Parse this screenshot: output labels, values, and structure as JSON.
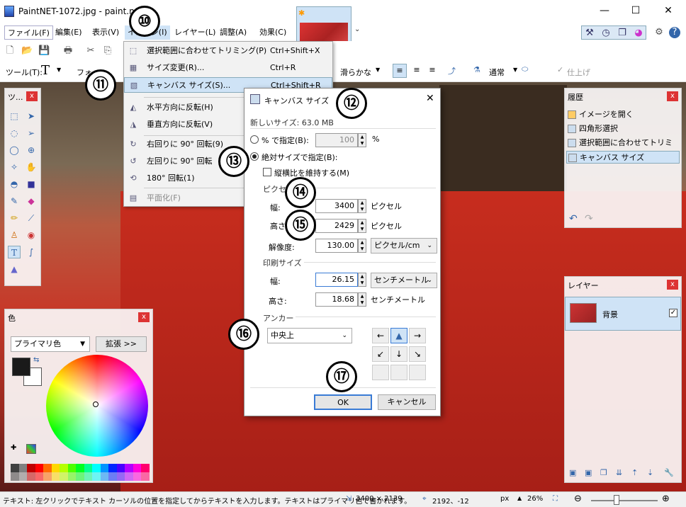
{
  "window": {
    "title": "PaintNET-1072.jpg - paint.net",
    "minimize": "—",
    "maximize": "☐",
    "close": "✕"
  },
  "menubar": {
    "items": [
      "ファイル(F)",
      "編集(E)",
      "表示(V)",
      "イメージ(I)",
      "レイヤー(L)",
      "調整(A)",
      "効果(C)"
    ]
  },
  "toolbar2": {
    "tool_label": "ツール(T):",
    "font_label": "フォ",
    "smoothing": "滑らかな",
    "blend": "通常",
    "finish": "仕上げ"
  },
  "image_menu": {
    "items": [
      {
        "label": "選択範囲に合わせてトリミング(P)",
        "shortcut": "Ctrl+Shift+X"
      },
      {
        "label": "サイズ変更(R)...",
        "shortcut": "Ctrl+R"
      },
      {
        "label": "キャンバス サイズ(S)...",
        "shortcut": "Ctrl+Shift+R"
      },
      {
        "label": "水平方向に反転(H)",
        "shortcut": ""
      },
      {
        "label": "垂直方向に反転(V)",
        "shortcut": ""
      },
      {
        "label": "右回りに 90° 回転(9)",
        "shortcut": ""
      },
      {
        "label": "左回りに 90° 回転",
        "shortcut": ""
      },
      {
        "label": "180° 回転(1)",
        "shortcut": ""
      },
      {
        "label": "平面化(F)",
        "shortcut": ""
      }
    ]
  },
  "tools_panel": {
    "title": "ツ..."
  },
  "colors_panel": {
    "title": "色",
    "mode": "プライマリ色",
    "expand": "拡張 >>",
    "primary_color": "#1a1a1a",
    "secondary_color": "#ffffff",
    "palette": [
      "#404040",
      "#808080",
      "#c00000",
      "#ff0000",
      "#ff6a00",
      "#ffd800",
      "#b6ff00",
      "#4cff00",
      "#00ff21",
      "#00ff90",
      "#00ffff",
      "#0094ff",
      "#0026ff",
      "#4800ff",
      "#b200ff",
      "#ff00dc",
      "#ff006e"
    ]
  },
  "history_panel": {
    "title": "履歴",
    "items": [
      "イメージを開く",
      "四角形選択",
      "選択範囲に合わせてトリミング",
      "キャンバス サイズ"
    ]
  },
  "layers_panel": {
    "title": "レイヤー",
    "layer_name": "背景"
  },
  "dialog": {
    "title": "キャンバス サイズ",
    "new_size": "新しいサイズ: 63.0 MB",
    "by_percent": "% で指定(B):",
    "percent_value": "100",
    "percent_unit": "%",
    "by_absolute": "絶対サイズで指定(B):",
    "keep_ratio": "縦横比を維持する(M)",
    "pixel_group": "ピクセ",
    "width_label": "幅:",
    "width_px": "3400",
    "height_label": "高さ:",
    "height_px": "2429",
    "pixel_unit": "ピクセル",
    "resolution_label": "解像度:",
    "resolution": "130.00",
    "resolution_unit": "ピクセル/cm",
    "print_group": "印刷サイズ",
    "print_width": "26.15",
    "print_height": "18.68",
    "cm_unit": "センチメートル",
    "anchor_group": "アンカー",
    "anchor_value": "中央上",
    "ok": "OK",
    "cancel": "キャンセル"
  },
  "callouts": [
    "⑩",
    "⑪",
    "⑫",
    "⑬",
    "⑭",
    "⑮",
    "⑯",
    "⑰"
  ],
  "status": {
    "hint": "テキスト: 左クリックでテキスト カーソルの位置を指定してからテキストを入力します。テキストはプライマリ色で書かれます。",
    "image_size": "3400 × 2139",
    "cursor_pos": "2192、-12",
    "unit": "px",
    "zoom": "26%"
  }
}
